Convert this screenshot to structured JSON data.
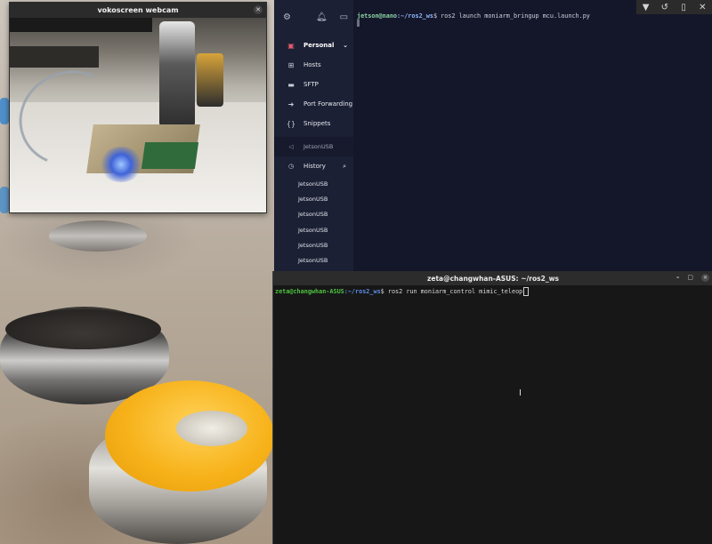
{
  "webcam": {
    "title": "vokoscreen webcam",
    "close_glyph": "✕"
  },
  "tray": {
    "icons": [
      "▼",
      "↺",
      "▯",
      "✕"
    ]
  },
  "termius": {
    "toolbar_icons": [
      "gear-icon",
      "bell-icon",
      "terminal-icon"
    ],
    "vault": "Personal",
    "nav": [
      {
        "label": "Hosts",
        "icon": "⊞"
      },
      {
        "label": "SFTP",
        "icon": "▬"
      },
      {
        "label": "Port Forwarding",
        "icon": "➜"
      },
      {
        "label": "Snippets",
        "icon": "{}"
      }
    ],
    "session": "JetsonUSB",
    "history_label": "History",
    "history": [
      "JetsonUSB",
      "JetsonUSB",
      "JetsonUSB",
      "JetsonUSB",
      "JetsonUSB",
      "JetsonUSB"
    ],
    "terminal": {
      "prompt": "jetson@nano",
      "path": ":~/ros2_ws",
      "command": "$ ros2 launch moniarm_bringup mcu.launch.py"
    }
  },
  "ubuntu_terminal": {
    "title": "zeta@changwhan-ASUS: ~/ros2_ws",
    "buttons": [
      "–",
      "▢",
      "✕"
    ],
    "prompt": "zeta@changwhan-ASUS",
    "path": ":~/ros2_ws",
    "command": "$ ros2 run moniarm_control mimic_teleop"
  }
}
